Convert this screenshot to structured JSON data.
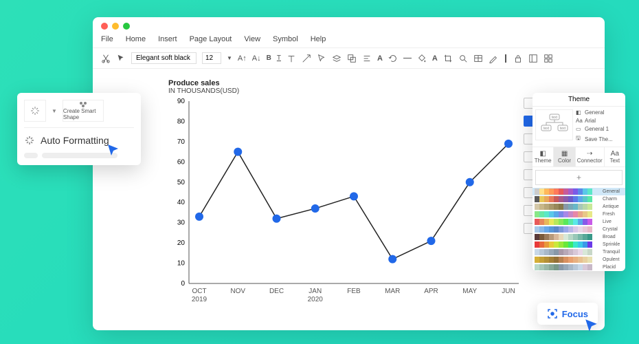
{
  "menu": [
    "File",
    "Home",
    "Insert",
    "Page Layout",
    "View",
    "Symbol",
    "Help"
  ],
  "toolbar": {
    "font": "Elegant soft black",
    "size": "12"
  },
  "chart_data": {
    "type": "line",
    "title": "Produce sales",
    "subtitle": "IN THOUSANDS(USD)",
    "x": [
      "OCT",
      "NOV",
      "DEC",
      "JAN",
      "FEB",
      "MAR",
      "APR",
      "MAY",
      "JUN"
    ],
    "x_sub": {
      "0": "2019",
      "3": "2020"
    },
    "values": [
      33,
      65,
      32,
      37,
      43,
      12,
      21,
      50,
      69
    ],
    "y_ticks": [
      0,
      10,
      20,
      30,
      40,
      50,
      60,
      70,
      80,
      90
    ],
    "ylim": [
      0,
      90
    ]
  },
  "popup": {
    "create_smart": "Create Smart Shape",
    "auto_format": "Auto Formatting"
  },
  "focus": {
    "label": "Focus"
  },
  "theme_panel": {
    "title": "Theme",
    "preview_items": [
      "General",
      "Arial",
      "General 1",
      "Save The..."
    ],
    "tabs": [
      "Theme",
      "Color",
      "Connector",
      "Text"
    ],
    "selected_tab": 1,
    "palettes": [
      "General",
      "Charm",
      "Antique",
      "Fresh",
      "Live",
      "Crystal",
      "Broad",
      "Sprinkle",
      "Tranquil",
      "Opulent",
      "Placid"
    ]
  },
  "palette_swatches": [
    [
      "#ccc",
      "#ffe08a",
      "#ffb85a",
      "#ff9a5a",
      "#ff7a5a",
      "#e85a5a",
      "#c85a9a",
      "#a85ac8",
      "#7a5ae8",
      "#5a8ae8",
      "#5ac8e8",
      "#5ae8c8"
    ],
    [
      "#5a5a5a",
      "#e8c85a",
      "#e8a85a",
      "#e87a5a",
      "#c85a5a",
      "#a85a8a",
      "#8a5aa8",
      "#6a5ac8",
      "#5a7ae8",
      "#5aa8e8",
      "#5ac8c8",
      "#5ae8a8"
    ],
    [
      "#d4c8a8",
      "#c8b88a",
      "#b8a87a",
      "#a8986a",
      "#98885a",
      "#88784a",
      "#8898a8",
      "#78a8b8",
      "#68b8c8",
      "#a8c8b8",
      "#b8d8a8",
      "#c8e898"
    ],
    [
      "#88e888",
      "#68e8a8",
      "#5ae8c8",
      "#5ac8e8",
      "#5aa8e8",
      "#7a88e8",
      "#a888e8",
      "#c888c8",
      "#e888a8",
      "#e8a888",
      "#e8c888",
      "#e8e888"
    ],
    [
      "#e85a5a",
      "#e8885a",
      "#e8b85a",
      "#e8e85a",
      "#b8e85a",
      "#88e85a",
      "#5ae85a",
      "#5ae8a8",
      "#5ae8e8",
      "#5aa8e8",
      "#885ae8",
      "#c85ae8"
    ],
    [
      "#a8c8e8",
      "#88b8e8",
      "#68a8e8",
      "#5a98d8",
      "#5a88c8",
      "#7a98d8",
      "#9aa8e8",
      "#b8b8e8",
      "#d8c8e8",
      "#e8d8e8",
      "#e8c8d8",
      "#e8b8c8"
    ],
    [
      "#5a3a3a",
      "#7a5a3a",
      "#9a7a5a",
      "#b89a7a",
      "#d8b89a",
      "#e8d8b8",
      "#d8e8d8",
      "#b8d8c8",
      "#98c8b8",
      "#78b8a8",
      "#58a898",
      "#389888"
    ],
    [
      "#e83a3a",
      "#e86a3a",
      "#e89a3a",
      "#e8ca3a",
      "#cae83a",
      "#9ae83a",
      "#6ae83a",
      "#3ae86a",
      "#3ae8ca",
      "#3acae8",
      "#3a9ae8",
      "#6a3ae8"
    ],
    [
      "#c8d8e8",
      "#b8c8d8",
      "#a8b8c8",
      "#98a8b8",
      "#8898a8",
      "#a898a8",
      "#b8a8b8",
      "#c8b8c8",
      "#d8c8d8",
      "#e8d8e8",
      "#d8e8d8",
      "#c8d8c8"
    ],
    [
      "#d4af37",
      "#c4a037",
      "#b49037",
      "#a48037",
      "#947037",
      "#b88050",
      "#d89060",
      "#e8a070",
      "#e8b080",
      "#e8c090",
      "#e8d0a0",
      "#e8e0b0"
    ],
    [
      "#b8d8c8",
      "#a8c8b8",
      "#98b8a8",
      "#88a898",
      "#789888",
      "#8898a8",
      "#98a8b8",
      "#a8b8c8",
      "#b8c8d8",
      "#c8d8e8",
      "#d8c8d8",
      "#c8b8c8"
    ]
  ]
}
